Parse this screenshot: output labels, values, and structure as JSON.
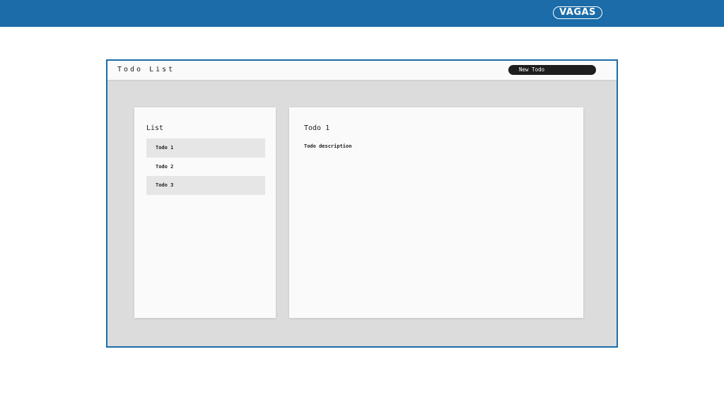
{
  "brand": {
    "logo_text": "VAGAS",
    "color": "#1b6ca8"
  },
  "app": {
    "title": "Todo List",
    "new_todo_label": "New Todo"
  },
  "list_panel": {
    "heading": "List",
    "items": [
      {
        "label": "Todo 1",
        "shaded": true
      },
      {
        "label": "Todo 2",
        "shaded": false
      },
      {
        "label": "Todo 3",
        "shaded": true
      }
    ]
  },
  "detail": {
    "title": "Todo 1",
    "description": "Todo description"
  }
}
